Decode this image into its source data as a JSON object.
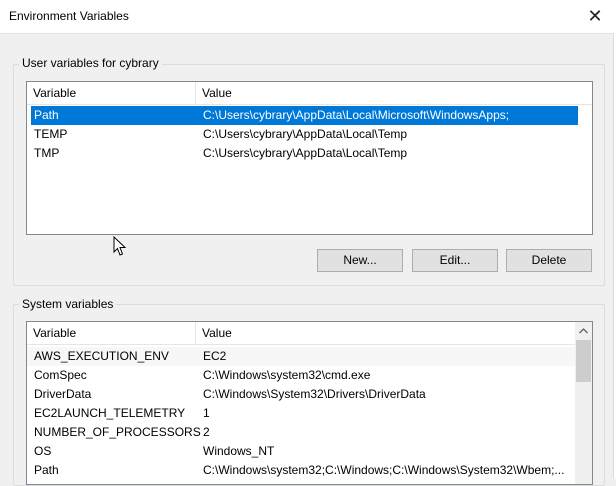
{
  "window": {
    "title": "Environment Variables",
    "close_glyph": "✕"
  },
  "user_section": {
    "label": "User variables for cybrary",
    "columns": [
      "Variable",
      "Value"
    ],
    "rows": [
      {
        "variable": "Path",
        "value": "C:\\Users\\cybrary\\AppData\\Local\\Microsoft\\WindowsApps;",
        "selected": true
      },
      {
        "variable": "TEMP",
        "value": "C:\\Users\\cybrary\\AppData\\Local\\Temp"
      },
      {
        "variable": "TMP",
        "value": "C:\\Users\\cybrary\\AppData\\Local\\Temp"
      }
    ],
    "buttons": {
      "new": "New...",
      "edit": "Edit...",
      "delete": "Delete"
    }
  },
  "system_section": {
    "label": "System variables",
    "columns": [
      "Variable",
      "Value"
    ],
    "rows": [
      {
        "variable": "AWS_EXECUTION_ENV",
        "value": "EC2"
      },
      {
        "variable": "ComSpec",
        "value": "C:\\Windows\\system32\\cmd.exe"
      },
      {
        "variable": "DriverData",
        "value": "C:\\Windows\\System32\\Drivers\\DriverData"
      },
      {
        "variable": "EC2LAUNCH_TELEMETRY",
        "value": "1"
      },
      {
        "variable": "NUMBER_OF_PROCESSORS",
        "value": "2"
      },
      {
        "variable": "OS",
        "value": "Windows_NT"
      },
      {
        "variable": "Path",
        "value": "C:\\Windows\\system32;C:\\Windows;C:\\Windows\\System32\\Wbem;..."
      }
    ]
  },
  "colors": {
    "selection": "#0078d7",
    "hover_row": "#e5f3ff"
  },
  "icons": {
    "close": "close-icon",
    "scroll_up": "chevron-up-icon",
    "cursor": "mouse-pointer-icon"
  }
}
